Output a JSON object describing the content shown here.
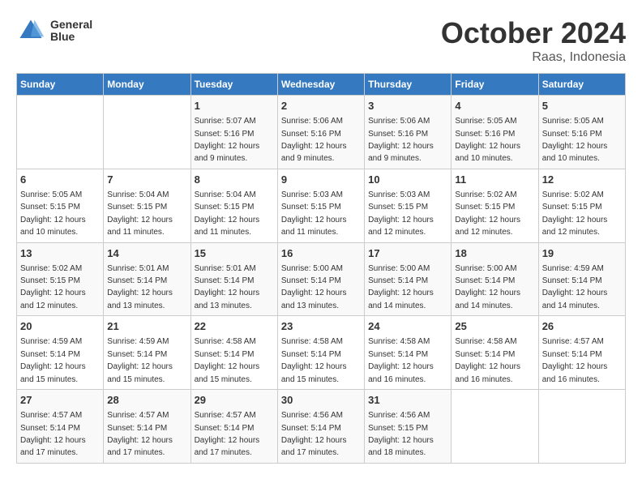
{
  "header": {
    "logo_text_line1": "General",
    "logo_text_line2": "Blue",
    "month": "October 2024",
    "location": "Raas, Indonesia"
  },
  "days_of_week": [
    "Sunday",
    "Monday",
    "Tuesday",
    "Wednesday",
    "Thursday",
    "Friday",
    "Saturday"
  ],
  "weeks": [
    [
      null,
      null,
      {
        "day": 1,
        "sunrise": "5:07 AM",
        "sunset": "5:16 PM",
        "daylight": "12 hours and 9 minutes."
      },
      {
        "day": 2,
        "sunrise": "5:06 AM",
        "sunset": "5:16 PM",
        "daylight": "12 hours and 9 minutes."
      },
      {
        "day": 3,
        "sunrise": "5:06 AM",
        "sunset": "5:16 PM",
        "daylight": "12 hours and 9 minutes."
      },
      {
        "day": 4,
        "sunrise": "5:05 AM",
        "sunset": "5:16 PM",
        "daylight": "12 hours and 10 minutes."
      },
      {
        "day": 5,
        "sunrise": "5:05 AM",
        "sunset": "5:16 PM",
        "daylight": "12 hours and 10 minutes."
      }
    ],
    [
      {
        "day": 6,
        "sunrise": "5:05 AM",
        "sunset": "5:15 PM",
        "daylight": "12 hours and 10 minutes."
      },
      {
        "day": 7,
        "sunrise": "5:04 AM",
        "sunset": "5:15 PM",
        "daylight": "12 hours and 11 minutes."
      },
      {
        "day": 8,
        "sunrise": "5:04 AM",
        "sunset": "5:15 PM",
        "daylight": "12 hours and 11 minutes."
      },
      {
        "day": 9,
        "sunrise": "5:03 AM",
        "sunset": "5:15 PM",
        "daylight": "12 hours and 11 minutes."
      },
      {
        "day": 10,
        "sunrise": "5:03 AM",
        "sunset": "5:15 PM",
        "daylight": "12 hours and 12 minutes."
      },
      {
        "day": 11,
        "sunrise": "5:02 AM",
        "sunset": "5:15 PM",
        "daylight": "12 hours and 12 minutes."
      },
      {
        "day": 12,
        "sunrise": "5:02 AM",
        "sunset": "5:15 PM",
        "daylight": "12 hours and 12 minutes."
      }
    ],
    [
      {
        "day": 13,
        "sunrise": "5:02 AM",
        "sunset": "5:15 PM",
        "daylight": "12 hours and 12 minutes."
      },
      {
        "day": 14,
        "sunrise": "5:01 AM",
        "sunset": "5:14 PM",
        "daylight": "12 hours and 13 minutes."
      },
      {
        "day": 15,
        "sunrise": "5:01 AM",
        "sunset": "5:14 PM",
        "daylight": "12 hours and 13 minutes."
      },
      {
        "day": 16,
        "sunrise": "5:00 AM",
        "sunset": "5:14 PM",
        "daylight": "12 hours and 13 minutes."
      },
      {
        "day": 17,
        "sunrise": "5:00 AM",
        "sunset": "5:14 PM",
        "daylight": "12 hours and 14 minutes."
      },
      {
        "day": 18,
        "sunrise": "5:00 AM",
        "sunset": "5:14 PM",
        "daylight": "12 hours and 14 minutes."
      },
      {
        "day": 19,
        "sunrise": "4:59 AM",
        "sunset": "5:14 PM",
        "daylight": "12 hours and 14 minutes."
      }
    ],
    [
      {
        "day": 20,
        "sunrise": "4:59 AM",
        "sunset": "5:14 PM",
        "daylight": "12 hours and 15 minutes."
      },
      {
        "day": 21,
        "sunrise": "4:59 AM",
        "sunset": "5:14 PM",
        "daylight": "12 hours and 15 minutes."
      },
      {
        "day": 22,
        "sunrise": "4:58 AM",
        "sunset": "5:14 PM",
        "daylight": "12 hours and 15 minutes."
      },
      {
        "day": 23,
        "sunrise": "4:58 AM",
        "sunset": "5:14 PM",
        "daylight": "12 hours and 15 minutes."
      },
      {
        "day": 24,
        "sunrise": "4:58 AM",
        "sunset": "5:14 PM",
        "daylight": "12 hours and 16 minutes."
      },
      {
        "day": 25,
        "sunrise": "4:58 AM",
        "sunset": "5:14 PM",
        "daylight": "12 hours and 16 minutes."
      },
      {
        "day": 26,
        "sunrise": "4:57 AM",
        "sunset": "5:14 PM",
        "daylight": "12 hours and 16 minutes."
      }
    ],
    [
      {
        "day": 27,
        "sunrise": "4:57 AM",
        "sunset": "5:14 PM",
        "daylight": "12 hours and 17 minutes."
      },
      {
        "day": 28,
        "sunrise": "4:57 AM",
        "sunset": "5:14 PM",
        "daylight": "12 hours and 17 minutes."
      },
      {
        "day": 29,
        "sunrise": "4:57 AM",
        "sunset": "5:14 PM",
        "daylight": "12 hours and 17 minutes."
      },
      {
        "day": 30,
        "sunrise": "4:56 AM",
        "sunset": "5:14 PM",
        "daylight": "12 hours and 17 minutes."
      },
      {
        "day": 31,
        "sunrise": "4:56 AM",
        "sunset": "5:15 PM",
        "daylight": "12 hours and 18 minutes."
      },
      null,
      null
    ]
  ]
}
